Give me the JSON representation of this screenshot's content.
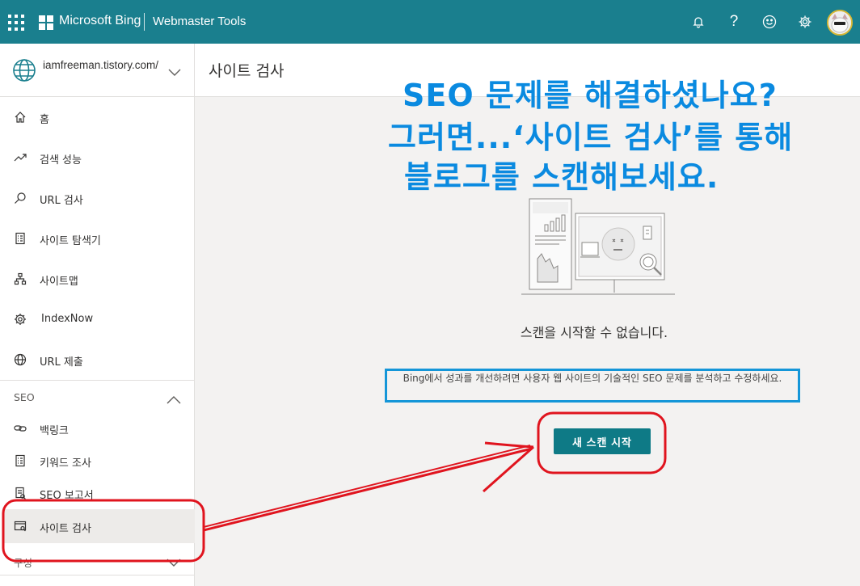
{
  "topbar": {
    "brand": "Microsoft Bing",
    "product": "Webmaster Tools",
    "icons": [
      "bell-icon",
      "help-icon",
      "feedback-smiley-icon",
      "settings-gear-icon"
    ]
  },
  "site": {
    "url": "iamfreeman.tistory.com/"
  },
  "nav": {
    "home": "홈",
    "search_performance": "검색 성능",
    "url_inspection": "URL 검사",
    "site_explorer": "사이트 탐색기",
    "sitemap": "사이트맵",
    "indexnow": "IndexNow",
    "url_submit": "URL 제출",
    "seo_section": "SEO",
    "backlinks": "백링크",
    "keyword_research": "키워드 조사",
    "seo_reports": "SEO 보고서",
    "site_scan": "사이트 검사",
    "config_section": "구성"
  },
  "main": {
    "page_title": "사이트 검사",
    "overlay_line1": "SEO 문제를 해결하셨나요?",
    "overlay_line2": "그러면...‘사이트 검사’를 통해",
    "overlay_line3": "블로그를 스캔해보세요.",
    "headline": "스캔을 시작할 수 없습니다.",
    "description": "Bing에서 성과를 개선하려면 사용자 웹 사이트의 기술적인 SEO 문제를 분석하고 수정하세요.",
    "start_button": "새 스캔 시작"
  },
  "colors": {
    "topbar": "#1a7f8e",
    "primary_button": "#0e7a86",
    "overlay_text": "#0a8ae0",
    "annotation_red": "#e0141e",
    "annotation_blue": "#1496d8"
  }
}
